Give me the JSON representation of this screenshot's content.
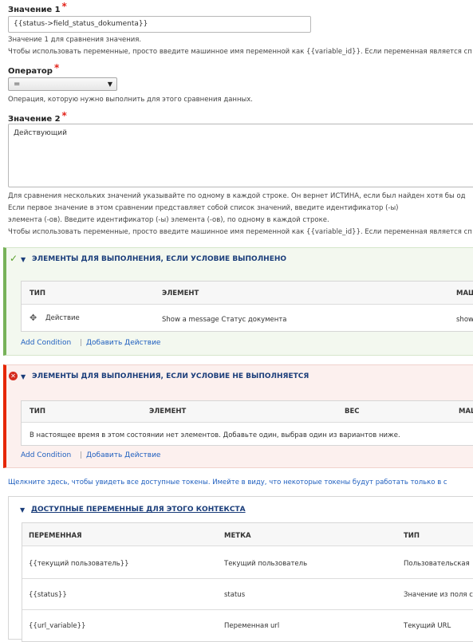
{
  "value1": {
    "label": "Значение 1",
    "required_mark": "*",
    "input_value": "{{status->field_status_dokumenta}}",
    "desc1": "Значение 1 для сравнения значения.",
    "desc2": "Чтобы использовать переменные, просто введите машинное имя переменной как {{variable_id}}. Если переменная является сп"
  },
  "operator": {
    "label": "Оператор",
    "required_mark": "*",
    "selected": "=",
    "desc": "Операция, которую нужно выполнить для этого сравнения данных."
  },
  "value2": {
    "label": "Значение 2",
    "required_mark": "*",
    "textarea_value": "Действующий",
    "desc1": "Для сравнения нескольких значений указывайте по одному в каждой строке. Он вернет ИСТИНА, если был найден хотя бы од",
    "desc2": "Если первое значение в этом сравнении представляет собой список значений, введите идентификатор (-ы)",
    "desc3": "элемента (-ов). Введите идентификатор (-ы) элемента (-ов), по одному в каждой строке.",
    "desc4": "Чтобы использовать переменные, просто введите машинное имя переменной как {{variable_id}}. Если переменная является сп"
  },
  "success_section": {
    "title": "ЭЛЕМЕНТЫ ДЛЯ ВЫПОЛНЕНИЯ, ЕСЛИ УСЛОВИЕ ВЫПОЛНЕНО",
    "columns": [
      "ТИП",
      "ЭЛЕМЕНТ",
      "МАШ"
    ],
    "row": {
      "type": "Действие",
      "element": "Show a message Статус документа",
      "machine": "show"
    },
    "add_condition": "Add Condition",
    "separator": "|",
    "add_action": "Добавить Действие",
    "accent_color": "#77b259"
  },
  "fail_section": {
    "title": "ЭЛЕМЕНТЫ ДЛЯ ВЫПОЛНЕНИЯ, ЕСЛИ УСЛОВИЕ НЕ ВЫПОЛНЯЕТСЯ",
    "columns": [
      "ТИП",
      "ЭЛЕМЕНТ",
      "ВЕС",
      "МАШ"
    ],
    "empty_text": "В настоящее время в этом состоянии нет элементов. Добавьте один, выбрав один из вариантов ниже.",
    "add_condition": "Add Condition",
    "separator": "|",
    "add_action": "Добавить Действие",
    "accent_color": "#e62600"
  },
  "tokens_link": "Щелкните здесь, чтобы увидеть все доступные токены. Имейте в виду, что некоторые токены будут работать только в с",
  "vars_section": {
    "title": "ДОСТУПНЫЕ ПЕРЕМЕННЫЕ ДЛЯ ЭТОГО КОНТЕКСТА",
    "columns": [
      "ПЕРЕМЕННАЯ",
      "МЕТКА",
      "ТИП"
    ],
    "rows": [
      {
        "variable": "{{текущий пользователь}}",
        "label": "Текущий пользователь",
        "type": "Пользовательская"
      },
      {
        "variable": "{{status}}",
        "label": "status",
        "type": "Значение из поля со"
      },
      {
        "variable": "{{url_variable}}",
        "label": "Переменная url",
        "type": "Текущий URL"
      }
    ]
  }
}
